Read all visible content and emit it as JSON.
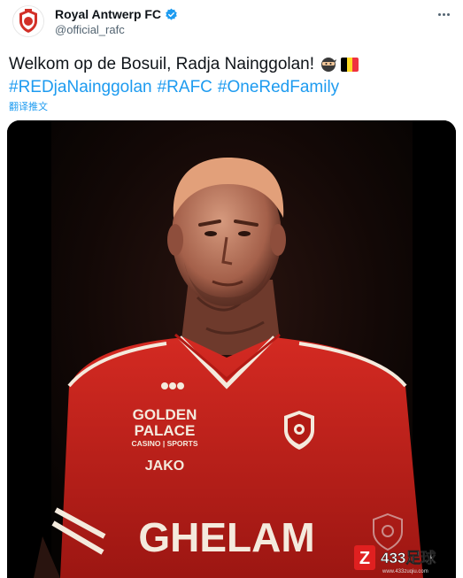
{
  "tweet": {
    "display_name": "Royal Antwerp FC",
    "handle": "@official_rafc",
    "text_line1": "Welkom op de Bosuil, Radja Nainggolan!",
    "hashtags": [
      "#REDjaNainggolan",
      "#RAFC",
      "#OneRedFamily"
    ],
    "translate_label": "翻译推文",
    "verified_color": "#1d9bf0"
  },
  "jersey": {
    "sponsor_line1": "GOLDEN",
    "sponsor_line2": "PALACE",
    "sponsor_line3": "CASINO | SPORTS",
    "kit_brand": "JAKO",
    "back_sponsor": "GHELAM"
  },
  "watermark": {
    "text": "433足球",
    "sub": "www.433zuqiu.com"
  },
  "colors": {
    "brand_red": "#d22f27",
    "jersey_red": "#c8231e",
    "link_blue": "#1d9bf0"
  }
}
